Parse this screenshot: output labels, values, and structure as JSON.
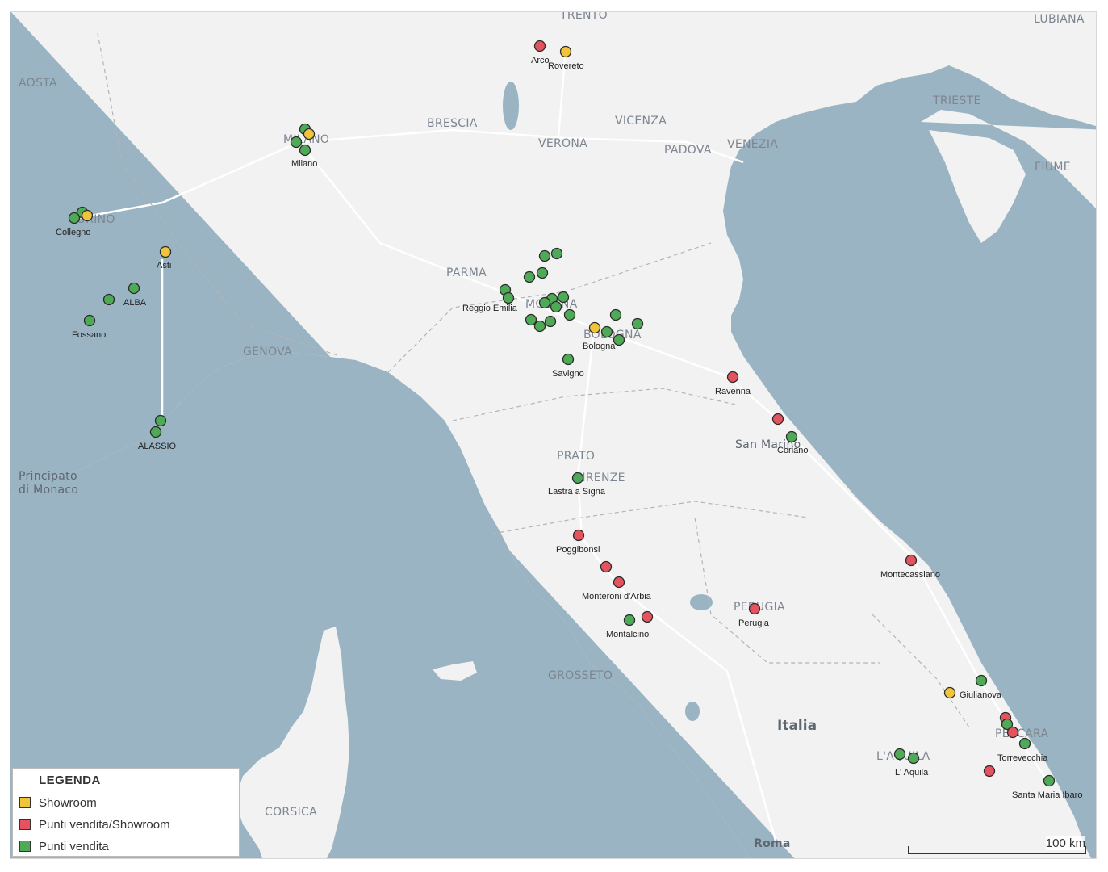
{
  "colors": {
    "sea": "#9ab4c3",
    "land": "#f2f2f2",
    "showroom": "#f0c53c",
    "punti_vendita_showroom": "#e4545f",
    "punti_vendita": "#4faa57"
  },
  "legend": {
    "title": "LEGENDA",
    "items": [
      {
        "label": "Showroom",
        "color": "#f0c53c"
      },
      {
        "label": "Punti vendita/Showroom",
        "color": "#e4545f"
      },
      {
        "label": "Punti vendita",
        "color": "#4faa57"
      }
    ]
  },
  "scale": {
    "label": "100 km"
  },
  "region_labels": [
    "TRENTO",
    "LUBIANA",
    "AOSTA",
    "TRIESTE",
    "BRESCIA",
    "VICENZA",
    "VERONA",
    "PADOVA",
    "VENEZIA",
    "FIUME",
    "PARMA",
    "GENOVA",
    "PRATO",
    "GROSSETO",
    "CORSICA",
    "L'AQUILA",
    "PESCARA",
    "PERUGIA",
    "BOLOGNA",
    "FIRENZE",
    "MODENA",
    "TORINO",
    "MILANO",
    "Principato",
    "di Monaco",
    "San Marino",
    "Italia",
    "Roma"
  ],
  "cities": [
    "Arco",
    "Rovereto",
    "Milano",
    "Collegno",
    "Asti",
    "ALBA",
    "Fossano",
    "ALASSIO",
    "Reggio Emilia",
    "Bologna",
    "Savigno",
    "Ravenna",
    "Coriano",
    "Lastra a Signa",
    "Poggibonsi",
    "Monteroni d'Arbia",
    "Montalcino",
    "Perugia",
    "Montecassiano",
    "Giulianova",
    "Torrevecchia",
    "L' Aquila",
    "Santa Maria Ibaro"
  ]
}
